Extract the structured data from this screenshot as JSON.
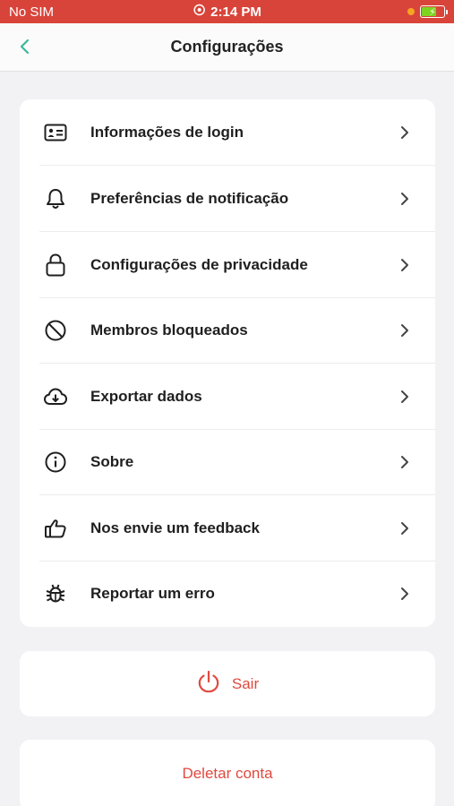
{
  "status_bar": {
    "carrier": "No SIM",
    "time": "2:14 PM",
    "battery_color": "#7ed321",
    "alarm_icon": "alarm-icon"
  },
  "header": {
    "title": "Configurações",
    "back_icon": "chevron-left-icon",
    "accent": "#3bb89c"
  },
  "menu": {
    "items": [
      {
        "label": "Informações de login",
        "icon": "id-card-icon"
      },
      {
        "label": "Preferências de notificação",
        "icon": "bell-icon"
      },
      {
        "label": "Configurações de privacidade",
        "icon": "lock-icon"
      },
      {
        "label": "Membros bloqueados",
        "icon": "block-icon"
      },
      {
        "label": "Exportar dados",
        "icon": "cloud-download-icon"
      },
      {
        "label": "Sobre",
        "icon": "info-icon"
      },
      {
        "label": "Nos envie um feedback",
        "icon": "thumbs-up-icon"
      },
      {
        "label": "Reportar um erro",
        "icon": "bug-icon"
      }
    ]
  },
  "actions": {
    "logout_label": "Sair",
    "logout_icon": "power-icon",
    "delete_label": "Deletar conta",
    "danger_color": "#e0493f"
  }
}
